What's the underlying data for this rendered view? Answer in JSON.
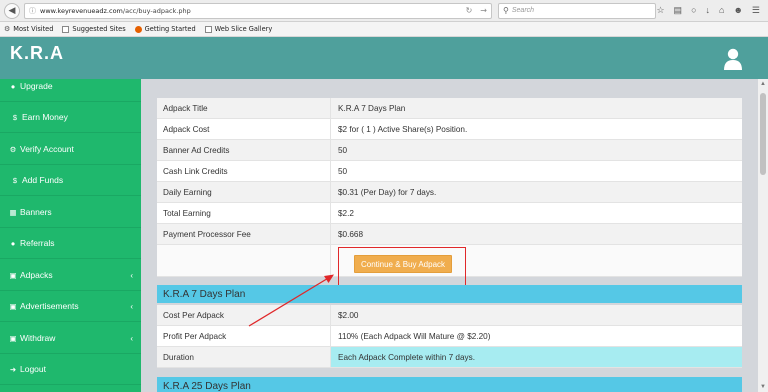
{
  "browser": {
    "url_host": "www.keyrevenueadz.com",
    "url_path": "/acc/buy-adpack.php",
    "search_placeholder": "Search",
    "bookmarks": [
      "Most Visited",
      "Suggested Sites",
      "Getting Started",
      "Web Slice Gallery"
    ]
  },
  "header": {
    "brand": "K.R.A"
  },
  "sidebar": {
    "items": [
      {
        "icon": "user-icon",
        "label": "Upgrade"
      },
      {
        "icon": "dollar-icon",
        "label": "Earn Money"
      },
      {
        "icon": "gear-icon",
        "label": "Verify Account"
      },
      {
        "icon": "dollar-icon",
        "label": "Add Funds"
      },
      {
        "icon": "table-icon",
        "label": "Banners"
      },
      {
        "icon": "user-icon",
        "label": "Referrals"
      },
      {
        "icon": "box-icon",
        "label": "Adpacks"
      },
      {
        "icon": "box-icon",
        "label": "Advertisements"
      },
      {
        "icon": "box-icon",
        "label": "Withdraw"
      },
      {
        "icon": "logout-icon",
        "label": "Logout"
      }
    ]
  },
  "adpack_table": {
    "rows": [
      {
        "label": "Adpack Title",
        "value": "K.R.A 7 Days Plan"
      },
      {
        "label": "Adpack Cost",
        "value": "$2 for ( 1 ) Active Share(s) Position."
      },
      {
        "label": "Banner Ad Credits",
        "value": "50"
      },
      {
        "label": "Cash Link Credits",
        "value": "50"
      },
      {
        "label": "Daily Earning",
        "value": "$0.31 (Per Day) for 7 days."
      },
      {
        "label": "Total Earning",
        "value": "$2.2"
      },
      {
        "label": "Payment Processor Fee",
        "value": "$0.668"
      }
    ],
    "button_label": "Continue & Buy Adpack"
  },
  "plan_7": {
    "title": "K.R.A 7 Days Plan",
    "rows": [
      {
        "label": "Cost Per Adpack",
        "value": "$2.00"
      },
      {
        "label": "Profit Per Adpack",
        "value": "110% (Each Adpack Will Mature @ $2.20)"
      },
      {
        "label": "Duration",
        "value": "Each Adpack Complete within 7 days."
      }
    ]
  },
  "plan_25": {
    "title": "K.R.A 25 Days Plan"
  },
  "colors": {
    "header": "#4fa09c",
    "sidebar": "#1fb86d",
    "plan_header": "#55c8e6",
    "button": "#f0ad4e",
    "annotation": "#e0282a"
  }
}
